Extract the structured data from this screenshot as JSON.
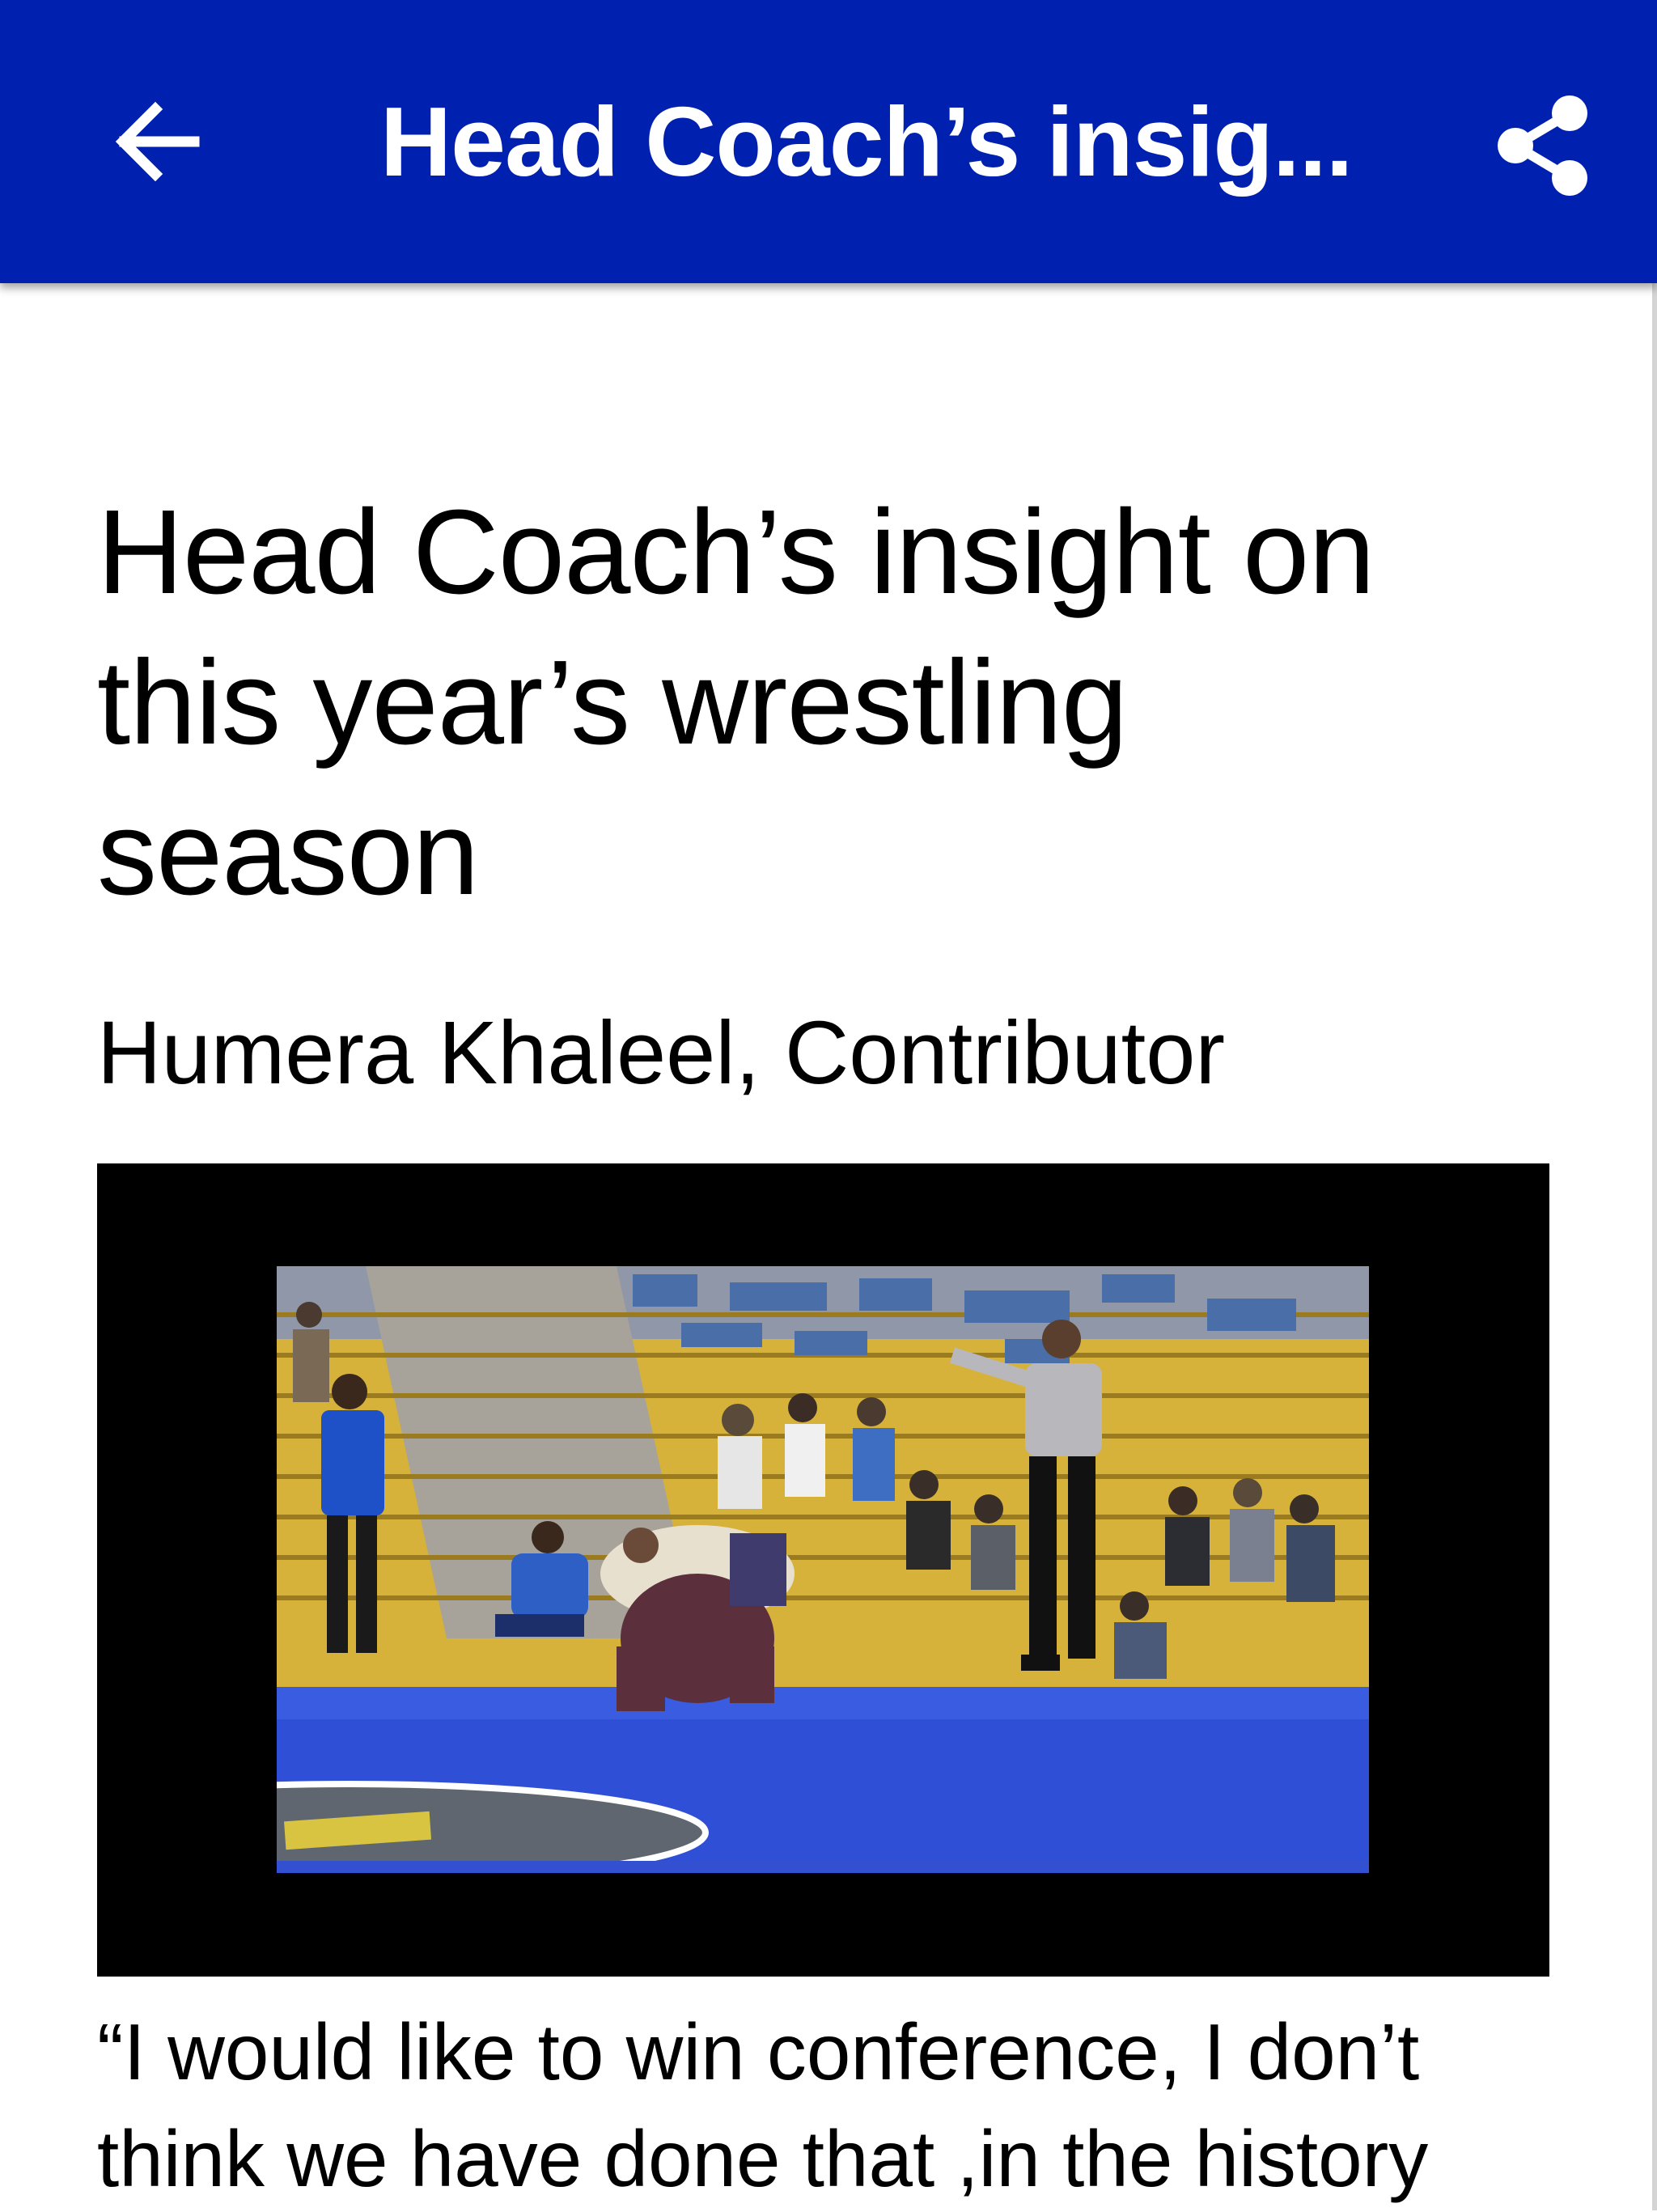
{
  "app_bar": {
    "title": "Head Coach’s insig...",
    "background": "#0020b0"
  },
  "article": {
    "headline": "Head Coach’s insight on this year’s wrestling season",
    "byline": "Humera Khaleel, Contributor",
    "media": {
      "type": "video",
      "scene_icon": "wrestling-video-thumbnail"
    },
    "body_first_lines": "“I would like to win conference, I don’t think we have done that ,in the history"
  },
  "icons": {
    "back": "arrow-left-icon",
    "share": "share-icon"
  }
}
